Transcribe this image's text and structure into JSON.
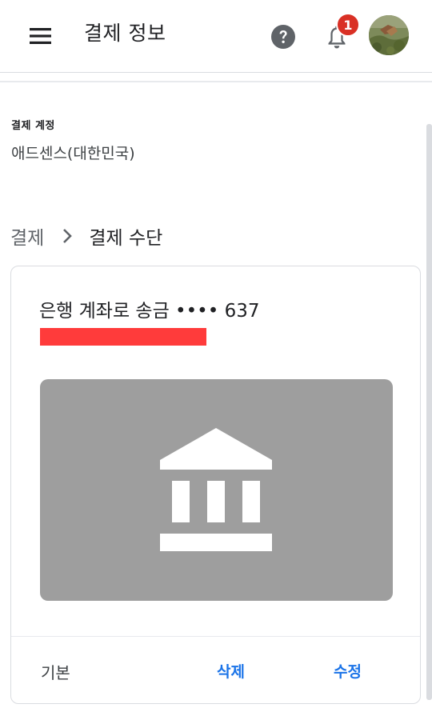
{
  "header": {
    "title": "결제 정보",
    "notification_count": "1",
    "icons": {
      "menu": "menu-icon",
      "help": "help-icon",
      "bell": "bell-icon"
    }
  },
  "account": {
    "label": "결제 계정",
    "name": "애드센스(대한민국)"
  },
  "breadcrumb": {
    "parent": "결제",
    "current": "결제 수단"
  },
  "payment_method": {
    "title": "은행 계좌로 송금 •••• 637",
    "default_label": "기본",
    "delete_label": "삭제",
    "edit_label": "수정",
    "image_icon": "bank-icon"
  },
  "colors": {
    "accent": "#1a73e8",
    "badge": "#d93025",
    "redaction": "#ff3b3b",
    "image_bg": "#9e9e9e"
  }
}
